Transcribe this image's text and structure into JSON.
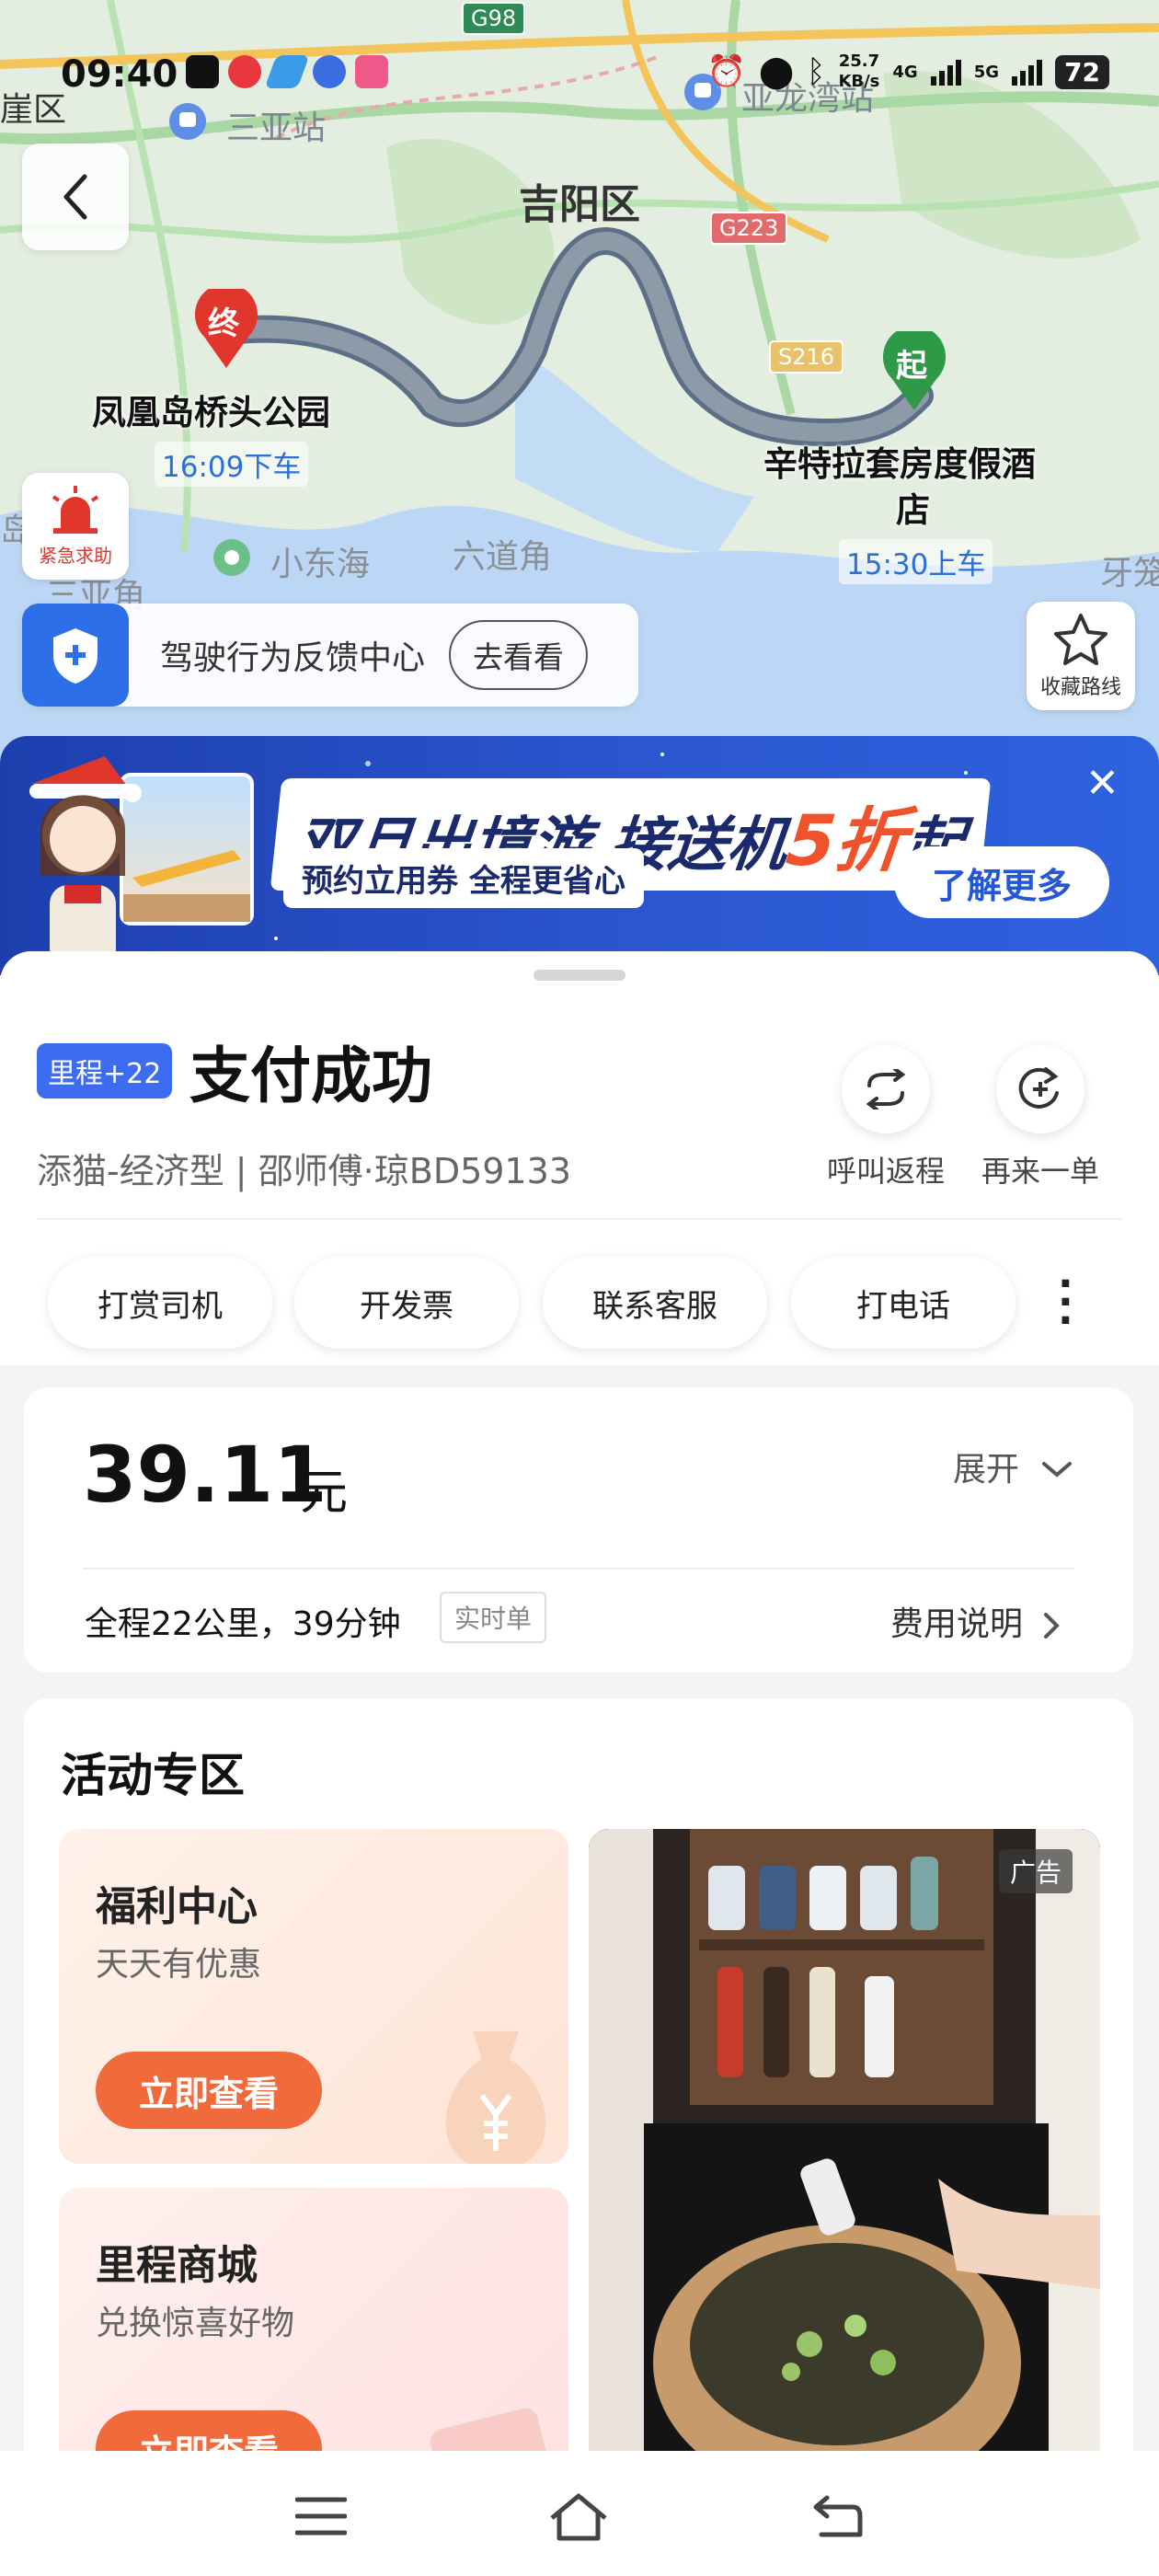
{
  "status_bar": {
    "time": "09:40",
    "speed_value": "25.7",
    "speed_unit": "KB/s",
    "network_1": "4G",
    "network_2": "5G",
    "battery": "72"
  },
  "map": {
    "places": {
      "district_left": "崖区",
      "station_1": "三亚站",
      "station_2": "亚龙湾站",
      "district": "吉阳区",
      "town_1": "小东海",
      "town_2": "六道角",
      "area_left": "三亚角",
      "area_right": "牙笼",
      "island_left": "岛"
    },
    "roads": [
      "G98",
      "G223",
      "S216"
    ],
    "end_marker": "终",
    "start_marker": "起",
    "destination_name": "凤凰岛桥头公园",
    "dropoff_time": "16:09下车",
    "origin_name_1": "辛特拉套房度假酒",
    "origin_name_2": "店",
    "pickup_time": "15:30上车"
  },
  "controls": {
    "sos_label": "紧急求助",
    "feedback_text": "驾驶行为反馈中心",
    "feedback_button": "去看看",
    "favorite_label": "收藏路线"
  },
  "banner": {
    "title_prefix": "双旦出境游 接送机",
    "title_highlight": "5折",
    "title_suffix": "起",
    "subtitle": "预约立用券 全程更省心",
    "button": "了解更多"
  },
  "order": {
    "mileage_badge": "里程+22",
    "status_title": "支付成功",
    "car_info": "添猫-经济型 | 邵师傅·琼BD59133",
    "actions": [
      {
        "label": "呼叫返程"
      },
      {
        "label": "再来一单"
      }
    ],
    "chips": [
      "打赏司机",
      "开发票",
      "联系客服",
      "打电话"
    ]
  },
  "fare": {
    "amount": "39.11",
    "unit": "元",
    "expand_label": "展开",
    "trip_summary": "全程22公里，39分钟",
    "trip_tag": "实时单",
    "fee_desc": "费用说明"
  },
  "activity": {
    "title": "活动专区",
    "tiles": [
      {
        "title": "福利中心",
        "subtitle": "天天有优惠",
        "button": "立即查看"
      },
      {
        "title": "里程商城",
        "subtitle": "兑换惊喜好物",
        "button": "立即查看"
      }
    ],
    "ad_tag": "广告"
  },
  "colors": {
    "accent_blue": "#2d6fe8",
    "route_gray": "#8e9aa8",
    "end_red": "#e0362b",
    "start_green": "#2e9a48",
    "cta_orange": "#f06a3c"
  }
}
